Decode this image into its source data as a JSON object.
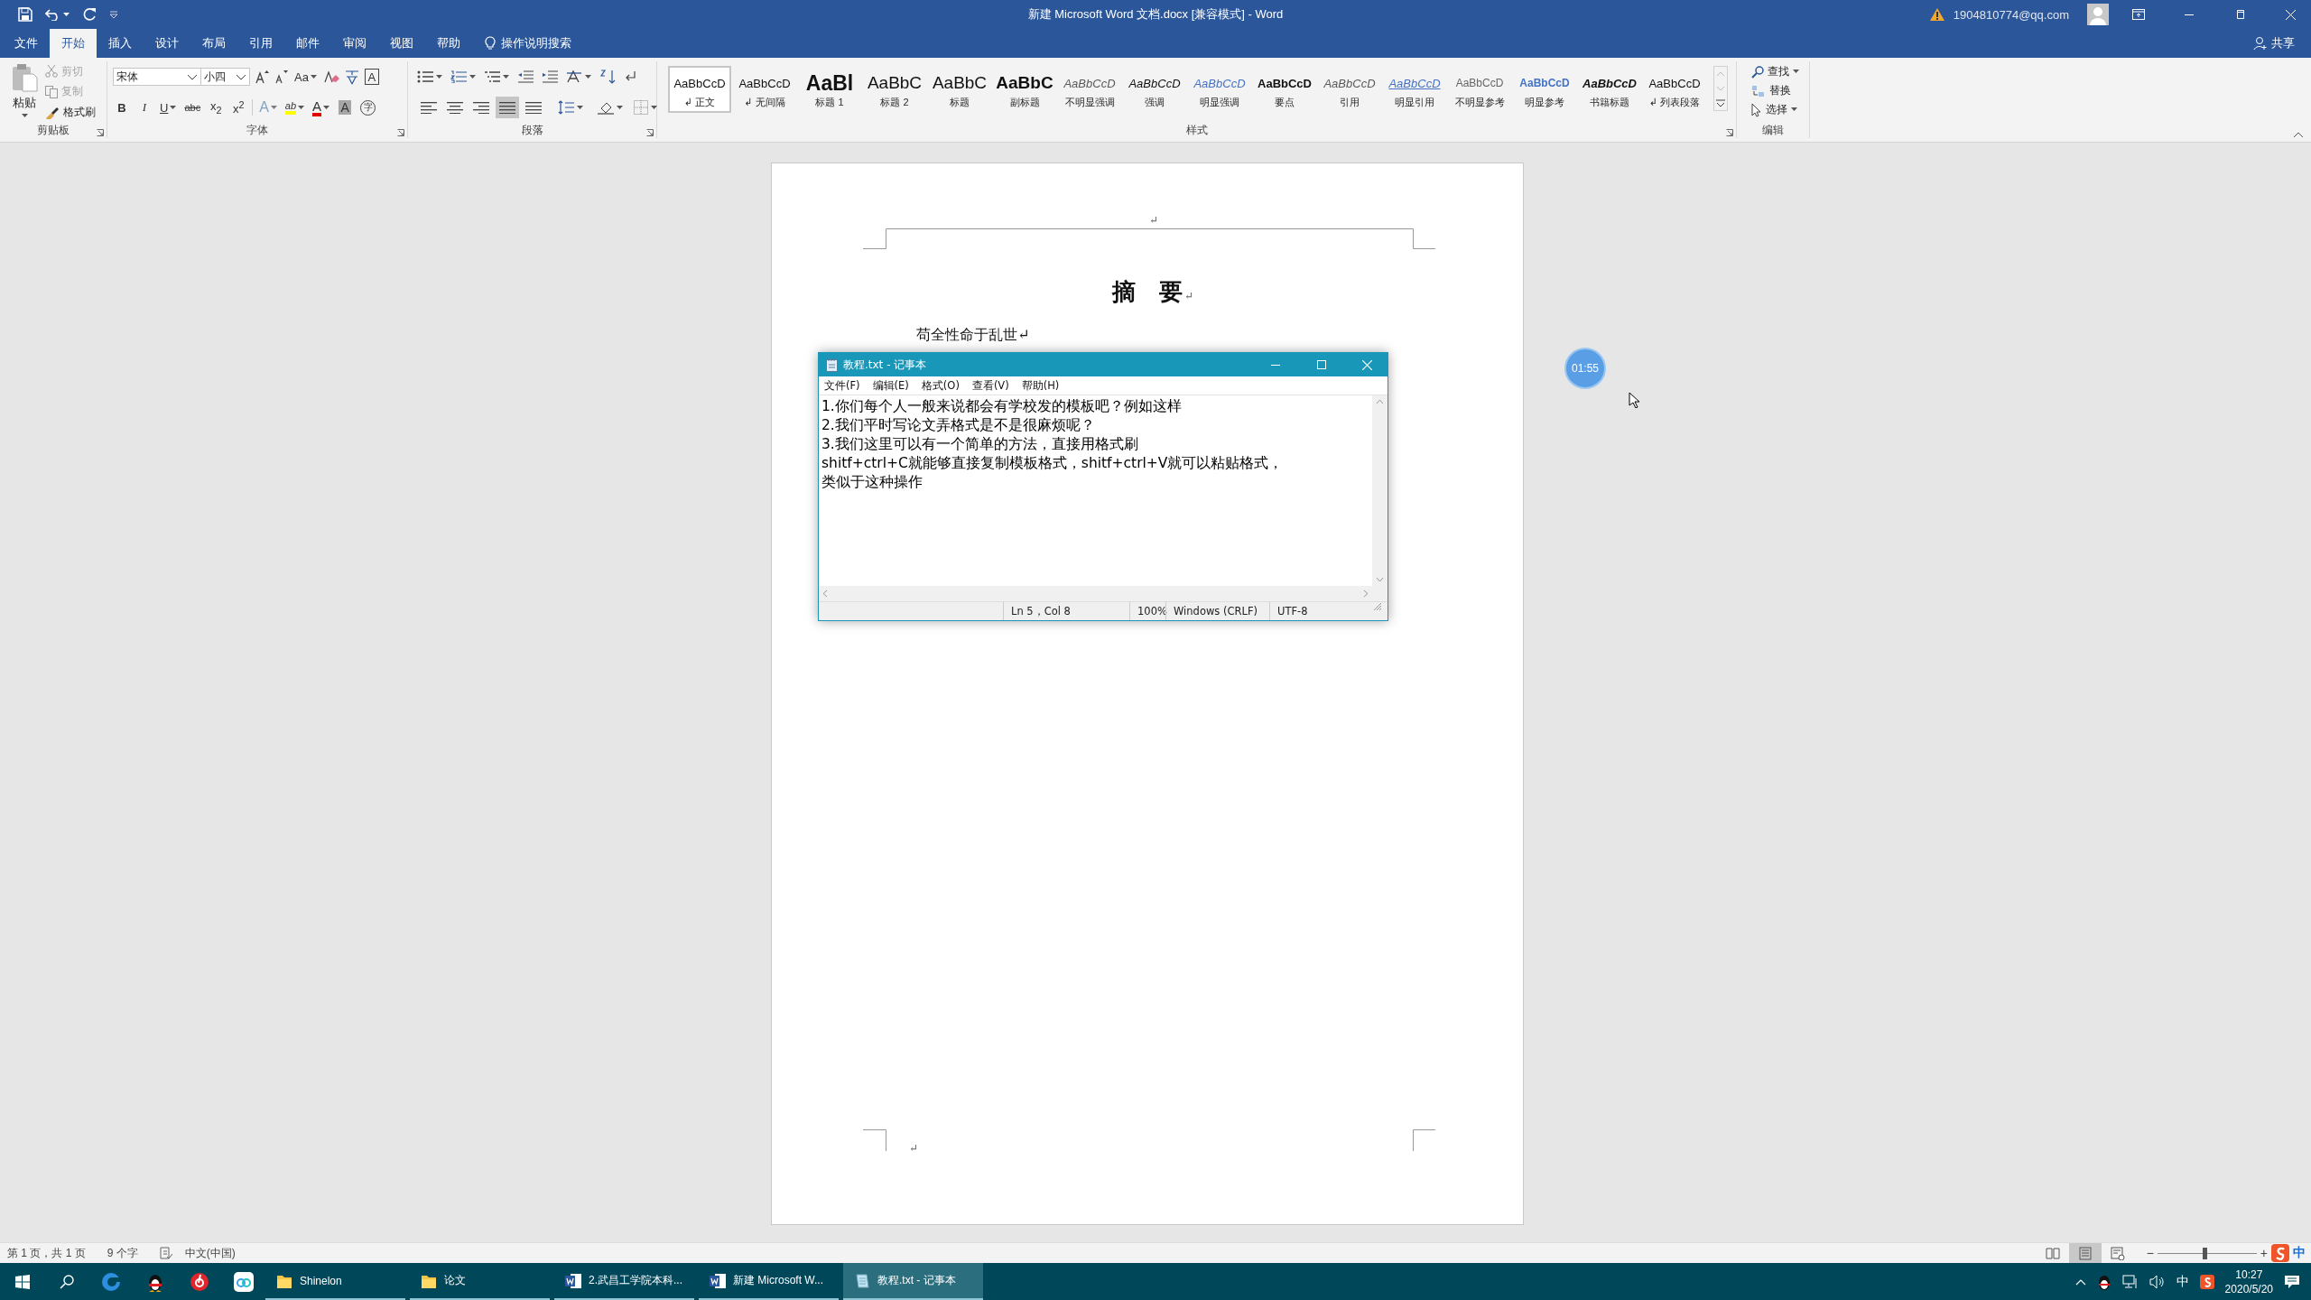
{
  "window": {
    "title": "新建 Microsoft Word 文档.docx [兼容模式] - Word",
    "account": "1904810774@qq.com"
  },
  "tabs": [
    {
      "label": "文件",
      "selected": false
    },
    {
      "label": "开始",
      "selected": true
    },
    {
      "label": "插入",
      "selected": false
    },
    {
      "label": "设计",
      "selected": false
    },
    {
      "label": "布局",
      "selected": false
    },
    {
      "label": "引用",
      "selected": false
    },
    {
      "label": "邮件",
      "selected": false
    },
    {
      "label": "审阅",
      "selected": false
    },
    {
      "label": "视图",
      "selected": false
    },
    {
      "label": "帮助",
      "selected": false
    }
  ],
  "tell_me": "操作说明搜索",
  "share": "共享",
  "ribbon": {
    "clipboard": {
      "label": "剪贴板",
      "paste": "粘贴",
      "cut": {
        "label": "剪切",
        "disabled": true
      },
      "copy": {
        "label": "复制",
        "disabled": true
      },
      "format_painter": {
        "label": "格式刷",
        "disabled": false
      }
    },
    "font": {
      "label": "字体",
      "font_name": "宋体",
      "font_size": "小四",
      "change_case": "Aa",
      "char_border": "A",
      "format_buttons": [
        {
          "label": "B",
          "kind": "bold"
        },
        {
          "label": "I",
          "kind": "italic"
        },
        {
          "label": "U",
          "kind": "underline"
        },
        {
          "label": "abc",
          "kind": "strike"
        },
        {
          "label": "x$_{2}$",
          "kind": "plain"
        },
        {
          "label": "x$^{2}$",
          "kind": "plain"
        }
      ],
      "effect_buttons": [
        {
          "label": "A",
          "kind": "text-effect",
          "disabled": true
        },
        {
          "label": "ab",
          "kind": "highlight",
          "disabled": false
        },
        {
          "label": "A",
          "kind": "font-color",
          "disabled": false
        },
        {
          "label": "A",
          "kind": "shading",
          "disabled": false
        },
        {
          "label": "字",
          "kind": "enclose",
          "disabled": false
        }
      ]
    },
    "paragraph": {
      "label": "段落",
      "alignment": [
        {
          "kind": "left",
          "selected": false
        },
        {
          "kind": "center",
          "selected": false
        },
        {
          "kind": "right",
          "selected": false
        },
        {
          "kind": "justify",
          "selected": true
        },
        {
          "kind": "distributed",
          "selected": false
        }
      ]
    },
    "styles": {
      "label": "样式",
      "items": [
        {
          "preview": "AaBbCcD",
          "name": "↲ 正文",
          "kind": "normal",
          "selected": true
        },
        {
          "preview": "AaBbCcD",
          "name": "↲ 无间隔",
          "kind": "normal",
          "selected": false
        },
        {
          "preview": "AaBl",
          "name": "标题 1",
          "kind": "heading1",
          "selected": false
        },
        {
          "preview": "AaBbC",
          "name": "标题 2",
          "kind": "heading2",
          "selected": false
        },
        {
          "preview": "AaBbC",
          "name": "标题",
          "kind": "title",
          "selected": false
        },
        {
          "preview": "AaBbC",
          "name": "副标题",
          "kind": "subtitle",
          "selected": false
        },
        {
          "preview": "AaBbCcD",
          "name": "不明显强调",
          "kind": "subtle",
          "selected": false
        },
        {
          "preview": "AaBbCcD",
          "name": "强调",
          "kind": "emphasis",
          "selected": false
        },
        {
          "preview": "AaBbCcD",
          "name": "明显强调",
          "kind": "intense",
          "selected": false
        },
        {
          "preview": "AaBbCcD",
          "name": "要点",
          "kind": "strong",
          "selected": false
        },
        {
          "preview": "AaBbCcD",
          "name": "引用",
          "kind": "subtle",
          "selected": false
        },
        {
          "preview": "AaBbCcD",
          "name": "明显引用",
          "kind": "intense-quote",
          "selected": false
        },
        {
          "preview": "AaBbCcD",
          "name": "不明显参考",
          "kind": "subtle-ref",
          "selected": false
        },
        {
          "preview": "AaBbCcD",
          "name": "明显参考",
          "kind": "intense-ref",
          "selected": false
        },
        {
          "preview": "AaBbCcD",
          "name": "书籍标题",
          "kind": "book",
          "selected": false
        },
        {
          "preview": "AaBbCcD",
          "name": "↲ 列表段落",
          "kind": "normal",
          "selected": false
        }
      ]
    },
    "editing": {
      "label": "编辑",
      "find": "查找",
      "replace": "替换",
      "select": "选择"
    }
  },
  "document": {
    "header_mark": "↵",
    "heading": "摘　要",
    "heading_mark": "↵",
    "body": "苟全性命于乱世↵",
    "footer_mark": "↵"
  },
  "notepad": {
    "title": "教程.txt - 记事本",
    "menu": [
      "文件(F)",
      "编辑(E)",
      "格式(O)",
      "查看(V)",
      "帮助(H)"
    ],
    "lines": [
      "1.你们每个人一般来说都会有学校发的模板吧？例如这样",
      "2.我们平时写论文弄格式是不是很麻烦呢？",
      "3.我们这里可以有一个简单的方法，直接用格式刷",
      "shitf+ctrl+C就能够直接复制模板格式，shitf+ctrl+V就可以粘贴格式，",
      "类似于这种操作"
    ],
    "status": [
      "Ln 5，Col 8",
      "100%",
      "Windows (CRLF)",
      "UTF-8"
    ]
  },
  "timer": "01:55",
  "status_bar": {
    "page": "第 1 页，共 1 页",
    "words": "9 个字",
    "language": "中文(中国)",
    "views": [
      {
        "kind": "read",
        "selected": false
      },
      {
        "kind": "print",
        "selected": true
      },
      {
        "kind": "web",
        "selected": false
      }
    ],
    "zoom": {
      "minus": "−",
      "plus": "+",
      "level": 0.47
    },
    "ime": "中"
  },
  "taskbar": {
    "windows": [
      {
        "label": "Shinelon",
        "kind": "folder",
        "selected": false
      },
      {
        "label": "论文",
        "kind": "folder",
        "selected": false
      },
      {
        "label": "2.武昌工学院本科...",
        "kind": "word",
        "selected": false
      },
      {
        "label": "新建 Microsoft W...",
        "kind": "word",
        "selected": false
      },
      {
        "label": "教程.txt - 记事本",
        "kind": "notepad",
        "selected": true
      }
    ],
    "ime": "中",
    "time": "10:27",
    "date": "2020/5/20"
  }
}
